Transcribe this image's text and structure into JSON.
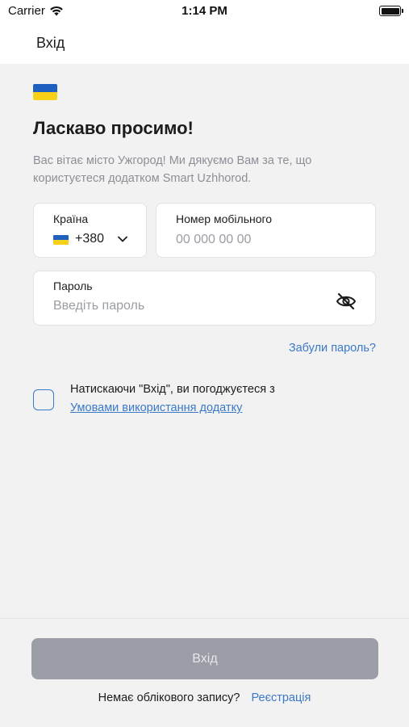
{
  "status_bar": {
    "carrier": "Carrier",
    "time": "1:14 PM",
    "icons": [
      "wifi-icon",
      "battery-icon"
    ]
  },
  "nav": {
    "title": "Вхід"
  },
  "welcome": {
    "title": "Ласкаво просимо!",
    "subtitle": "Вас вітає місто Ужгород! Ми дякуємо Вам за те, що користуєтеся додатком Smart Uzhhorod."
  },
  "form": {
    "country": {
      "label": "Країна",
      "code": "+380",
      "flag_colors": [
        "#1f5fbf",
        "#f7d117"
      ]
    },
    "phone": {
      "label": "Номер мобільного",
      "placeholder": "00 000 00 00",
      "value": ""
    },
    "password": {
      "label": "Пароль",
      "placeholder": "Введіть пароль",
      "value": ""
    },
    "forgot_password": "Забули пароль?",
    "agreement": {
      "text": "Натискаючи \"Вхід\", ви погоджуєтеся з",
      "link": "Умовами використання додатку",
      "checked": false
    }
  },
  "footer": {
    "login_button": "Вхід",
    "no_account": "Немає облікового запису?",
    "register": "Реєстрація"
  },
  "colors": {
    "accent": "#3b79c9",
    "background": "#f2f2f3",
    "button_disabled": "#9b9ea6"
  }
}
